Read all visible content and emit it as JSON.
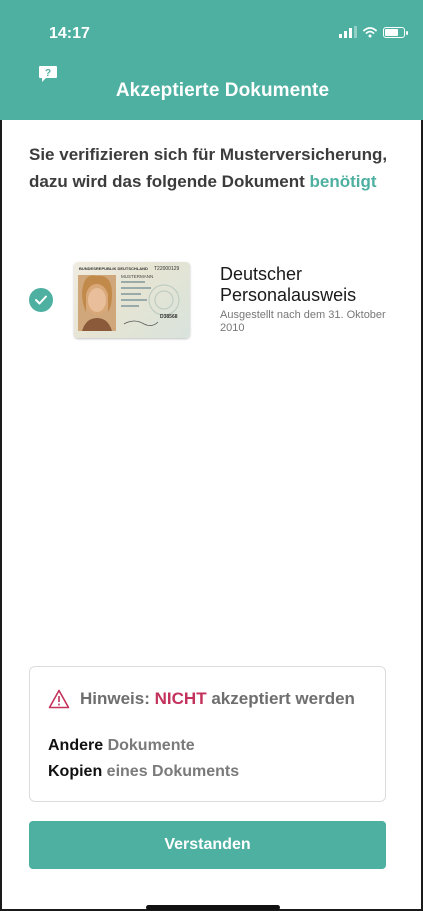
{
  "status_bar": {
    "time": "14:17"
  },
  "header": {
    "title": "Akzeptierte Dokumente",
    "help_icon": "help-bubble-icon",
    "help_glyph": "?",
    "background": "#4db0a1"
  },
  "intro": {
    "prefix": "Sie verifizieren sich für Musterversicherung, dazu wird das folgende Dokument ",
    "highlight": "benötigt"
  },
  "documents": [
    {
      "title_line1": "Deutscher",
      "title_line2": "Personalausweis",
      "subtitle": "Ausgestellt nach dem 31. Oktober 2010",
      "selected": true,
      "card_header": "BUNDESREPUBLIK DEUTSCHLAND",
      "card_number": "T22000129",
      "card_field": "MUSTERMANN",
      "card_code": "D38568"
    }
  ],
  "notice": {
    "icon": "warning-triangle-icon",
    "label": "Hinweis:",
    "nicht": "NICHT",
    "rest": "akzeptiert werden",
    "items": [
      {
        "strong": "Andere",
        "rest": "Dokumente"
      },
      {
        "strong": "Kopien",
        "rest": "eines Dokuments"
      }
    ]
  },
  "button": {
    "label": "Verstanden"
  },
  "colors": {
    "accent": "#4db0a1",
    "warning": "#c3325c"
  }
}
